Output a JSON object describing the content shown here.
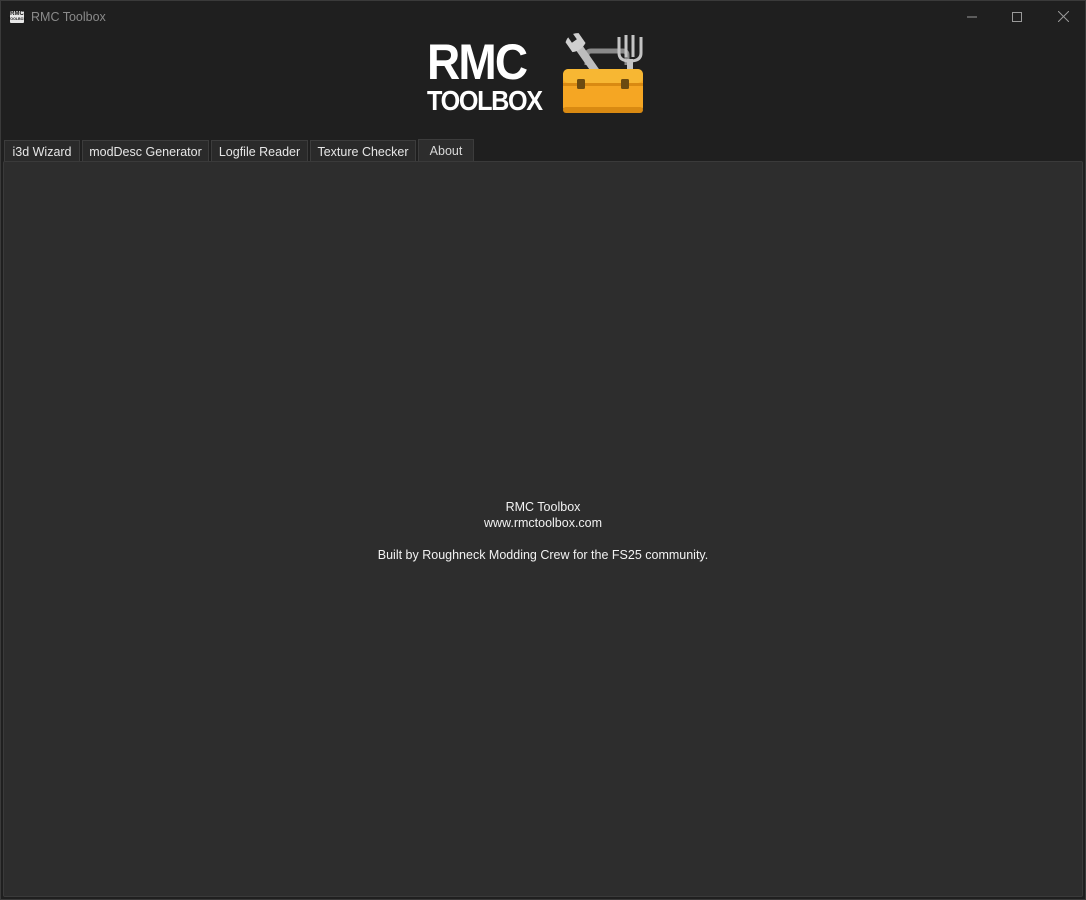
{
  "window": {
    "title": "RMC Toolbox",
    "icon": "rmc-toolbox-app-icon",
    "app_icon_lines": [
      "RMC",
      "TOOLBOX"
    ],
    "controls": [
      "minimize-icon",
      "maximize-icon",
      "close-icon"
    ]
  },
  "header": {
    "logo_line1": "RMC",
    "logo_line2": "TOOLBOX",
    "logo_icon": "toolbox-icon"
  },
  "tabs": [
    {
      "label": "i3d Wizard",
      "active": false
    },
    {
      "label": "modDesc Generator",
      "active": false
    },
    {
      "label": "Logfile Reader",
      "active": false
    },
    {
      "label": "Texture Checker",
      "active": false
    },
    {
      "label": "About",
      "active": true
    }
  ],
  "about": {
    "app_name": "RMC Toolbox",
    "website": "www.rmctoolbox.com",
    "credits": "Built by Roughneck Modding Crew for the FS25 community."
  },
  "colors": {
    "background": "#1f1f1f",
    "panel": "#2d2d2d",
    "toolbox_yellow": "#f5a623"
  }
}
